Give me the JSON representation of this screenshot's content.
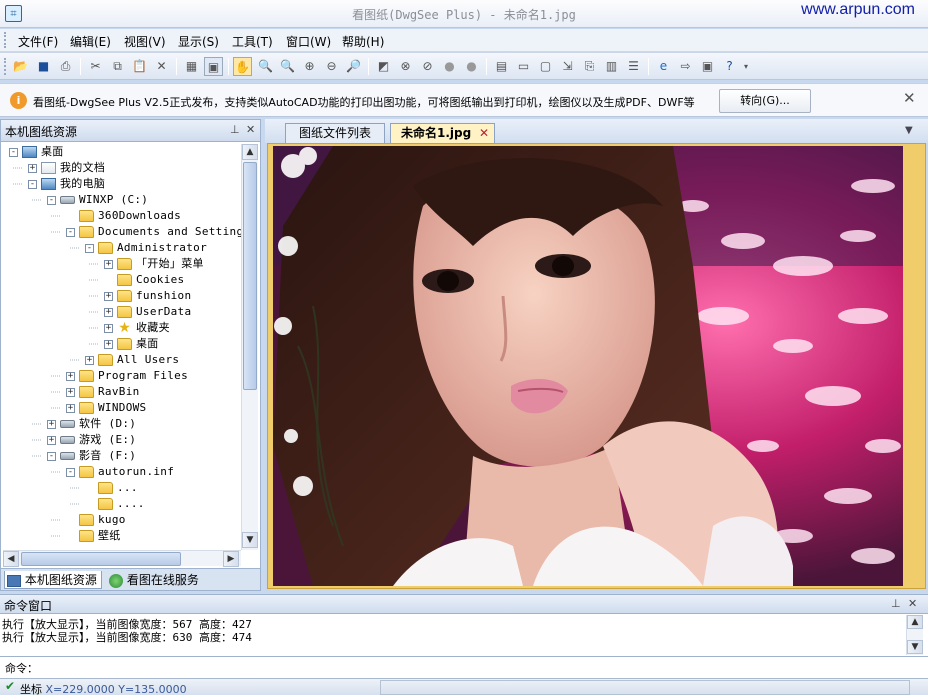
{
  "window": {
    "title": "看图纸(DwgSee Plus) - 未命名1.jpg",
    "watermark": "www.arpun.com"
  },
  "menu": [
    "文件(F)",
    "编辑(E)",
    "视图(V)",
    "显示(S)",
    "工具(T)",
    "窗口(W)",
    "帮助(H)"
  ],
  "infobar": {
    "text": "看图纸-DwgSee Plus V2.5正式发布，支持类似AutoCAD功能的打印出图功能，可将图纸输出到打印机，绘图仪以及生成PDF、DWF等",
    "button_label": "转向(G)..."
  },
  "left_panel": {
    "title": "本机图纸资源",
    "tabs": [
      "本机图纸资源",
      "看图在线服务"
    ],
    "tree": [
      {
        "label": "桌面",
        "depth": 0,
        "exp": "-",
        "icon": "desktop"
      },
      {
        "label": "我的文档",
        "depth": 1,
        "exp": "+",
        "icon": "doc"
      },
      {
        "label": "我的电脑",
        "depth": 1,
        "exp": "-",
        "icon": "pc"
      },
      {
        "label": "WINXP (C:)",
        "depth": 2,
        "exp": "-",
        "icon": "drive"
      },
      {
        "label": "360Downloads",
        "depth": 3,
        "exp": "",
        "icon": "folder"
      },
      {
        "label": "Documents and Settings",
        "depth": 3,
        "exp": "-",
        "icon": "folder"
      },
      {
        "label": "Administrator",
        "depth": 4,
        "exp": "-",
        "icon": "folder"
      },
      {
        "label": "「开始」菜单",
        "depth": 5,
        "exp": "+",
        "icon": "folder"
      },
      {
        "label": "Cookies",
        "depth": 5,
        "exp": "",
        "icon": "folder"
      },
      {
        "label": "funshion",
        "depth": 5,
        "exp": "+",
        "icon": "folder"
      },
      {
        "label": "UserData",
        "depth": 5,
        "exp": "+",
        "icon": "folder"
      },
      {
        "label": "收藏夹",
        "depth": 5,
        "exp": "+",
        "icon": "star"
      },
      {
        "label": "桌面",
        "depth": 5,
        "exp": "+",
        "icon": "folder"
      },
      {
        "label": "All Users",
        "depth": 4,
        "exp": "+",
        "icon": "folder"
      },
      {
        "label": "Program Files",
        "depth": 3,
        "exp": "+",
        "icon": "folder"
      },
      {
        "label": "RavBin",
        "depth": 3,
        "exp": "+",
        "icon": "folder"
      },
      {
        "label": "WINDOWS",
        "depth": 3,
        "exp": "+",
        "icon": "folder"
      },
      {
        "label": "软件 (D:)",
        "depth": 2,
        "exp": "+",
        "icon": "drive"
      },
      {
        "label": "游戏 (E:)",
        "depth": 2,
        "exp": "+",
        "icon": "drive"
      },
      {
        "label": "影音 (F:)",
        "depth": 2,
        "exp": "-",
        "icon": "drive"
      },
      {
        "label": "autorun.inf",
        "depth": 3,
        "exp": "-",
        "icon": "folder"
      },
      {
        "label": "...",
        "depth": 4,
        "exp": "",
        "icon": "folder"
      },
      {
        "label": "....",
        "depth": 4,
        "exp": "",
        "icon": "folder"
      },
      {
        "label": "kugo",
        "depth": 3,
        "exp": "",
        "icon": "folder"
      },
      {
        "label": "壁纸",
        "depth": 3,
        "exp": "",
        "icon": "folder"
      }
    ]
  },
  "doc_tabs": [
    {
      "label": "图纸文件列表",
      "active": false
    },
    {
      "label": "未命名1.jpg",
      "active": true
    }
  ],
  "command_window": {
    "title": "命令窗口",
    "lines": [
      "执行【放大显示】，当前图像宽度：567 高度：427",
      "执行【放大显示】，当前图像宽度：630 高度：474"
    ],
    "prompt": "命令："
  },
  "status": {
    "label": "坐标",
    "value": "X=229.0000 Y=135.0000"
  },
  "colors": {
    "frame_accent": "#f1cc6a",
    "watermark": "#1220a8",
    "panel_bg": "#c9d7eb"
  }
}
